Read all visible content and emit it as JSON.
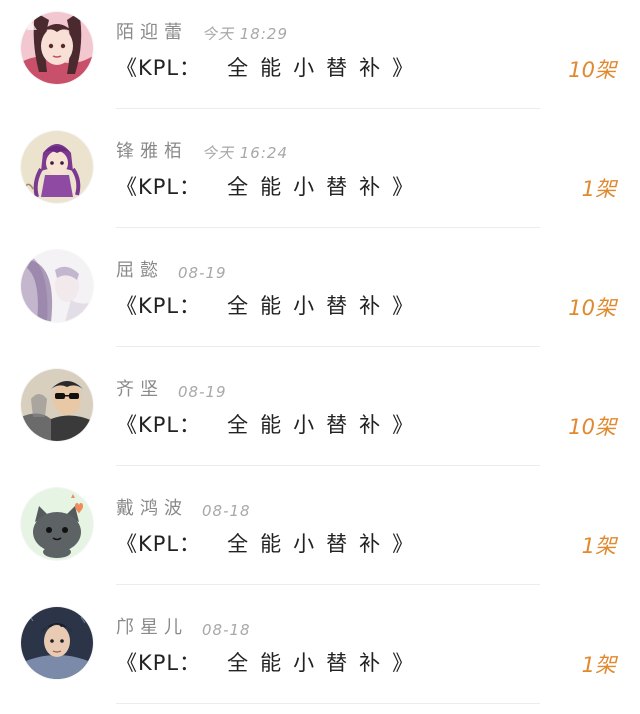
{
  "accent_color": "#e0892f",
  "gifts": [
    {
      "name": "陌迎蕾",
      "date": "今天 18:29",
      "title_prefix": "《KPL：",
      "title_rest": "全能小替补》",
      "count": "10架",
      "avatar_icon": "anime-girl-pink-avatar"
    },
    {
      "name": "锋雅栢",
      "date": "今天 16:24",
      "title_prefix": "《KPL：",
      "title_rest": "全能小替补》",
      "count": "1架",
      "avatar_icon": "purple-hair-girl-avatar"
    },
    {
      "name": "屈懿",
      "date": "08-19",
      "title_prefix": "《KPL：",
      "title_rest": "全能小替补》",
      "count": "10架",
      "avatar_icon": "pale-purple-hair-avatar"
    },
    {
      "name": "齐坚",
      "date": "08-19",
      "title_prefix": "《KPL：",
      "title_rest": "全能小替补》",
      "count": "10架",
      "avatar_icon": "man-sunglasses-avatar"
    },
    {
      "name": "戴鸿波",
      "date": "08-18",
      "title_prefix": "《KPL：",
      "title_rest": "全能小替补》",
      "count": "1架",
      "avatar_icon": "grey-cat-avatar"
    },
    {
      "name": "邝星儿",
      "date": "08-18",
      "title_prefix": "《KPL：",
      "title_rest": "全能小替补》",
      "count": "1架",
      "avatar_icon": "young-man-avatar"
    }
  ]
}
